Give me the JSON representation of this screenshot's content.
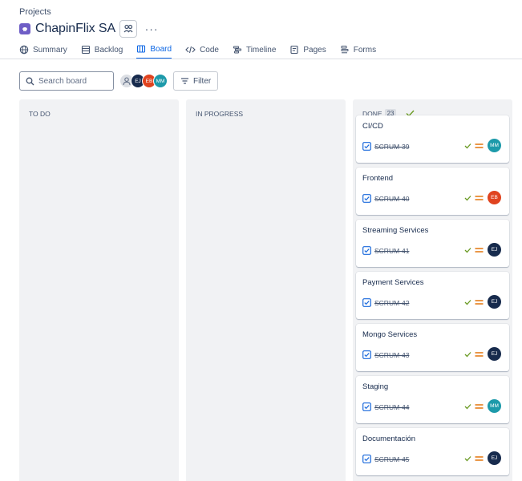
{
  "breadcrumb": "Projects",
  "project": {
    "title": "ChapinFlix SA",
    "more": "···"
  },
  "tabs": [
    {
      "label": "Summary",
      "icon": "globe-icon",
      "active": false
    },
    {
      "label": "Backlog",
      "icon": "backlog-icon",
      "active": false
    },
    {
      "label": "Board",
      "icon": "board-icon",
      "active": true
    },
    {
      "label": "Code",
      "icon": "code-icon",
      "active": false
    },
    {
      "label": "Timeline",
      "icon": "timeline-icon",
      "active": false
    },
    {
      "label": "Pages",
      "icon": "pages-icon",
      "active": false
    },
    {
      "label": "Forms",
      "icon": "forms-icon",
      "active": false
    }
  ],
  "toolbar": {
    "search_placeholder": "Search board",
    "filter_label": "Filter",
    "avatars": [
      {
        "initials": "",
        "color": "#dcdfe4",
        "icon": "unassigned-user-icon"
      },
      {
        "initials": "EJ",
        "color": "#172b4d"
      },
      {
        "initials": "EB",
        "color": "#e0431f"
      },
      {
        "initials": "MM",
        "color": "#1d9aaa"
      }
    ]
  },
  "columns": {
    "todo": {
      "label": "TO DO"
    },
    "progress": {
      "label": "IN PROGRESS"
    },
    "done": {
      "label": "DONE",
      "count": "23"
    }
  },
  "cards": [
    {
      "title": "CI/CD",
      "key": "SCRUM-39",
      "assignee": "MM",
      "color": "#1d9aaa"
    },
    {
      "title": "Frontend",
      "key": "SCRUM-40",
      "assignee": "EB",
      "color": "#e0431f"
    },
    {
      "title": "Streaming Services",
      "key": "SCRUM-41",
      "assignee": "EJ",
      "color": "#172b4d"
    },
    {
      "title": "Payment Services",
      "key": "SCRUM-42",
      "assignee": "EJ",
      "color": "#172b4d"
    },
    {
      "title": "Mongo Services",
      "key": "SCRUM-43",
      "assignee": "EJ",
      "color": "#172b4d"
    },
    {
      "title": "Staging",
      "key": "SCRUM-44",
      "assignee": "MM",
      "color": "#1d9aaa"
    },
    {
      "title": "Documentación",
      "key": "SCRUM-45",
      "assignee": "EJ",
      "color": "#172b4d"
    }
  ],
  "colors": {
    "accent": "#0c66e4",
    "done_check": "#6a9a23",
    "priority_medium": "#e2740b",
    "story_blue": "#1868db"
  }
}
